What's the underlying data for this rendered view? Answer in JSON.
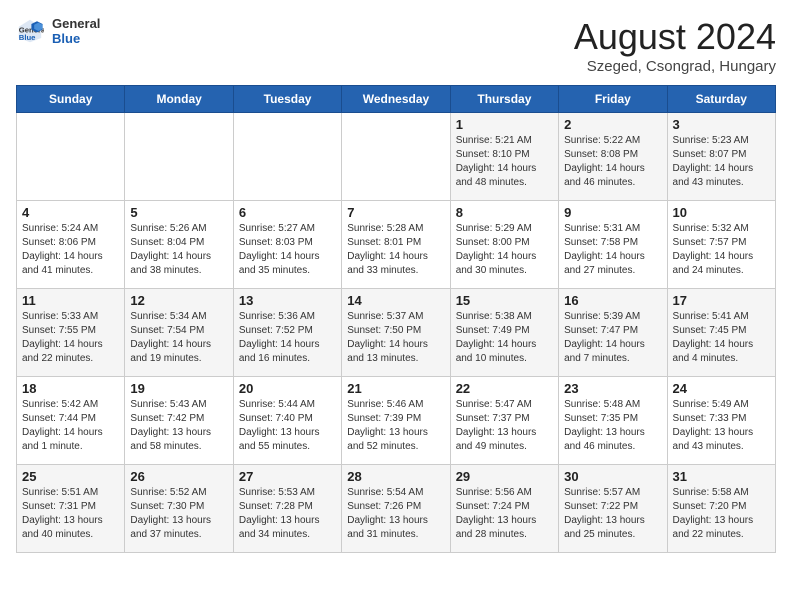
{
  "header": {
    "logo_general": "General",
    "logo_blue": "Blue",
    "title": "August 2024",
    "location": "Szeged, Csongrad, Hungary"
  },
  "days_of_week": [
    "Sunday",
    "Monday",
    "Tuesday",
    "Wednesday",
    "Thursday",
    "Friday",
    "Saturday"
  ],
  "weeks": [
    [
      {
        "day": "",
        "info": ""
      },
      {
        "day": "",
        "info": ""
      },
      {
        "day": "",
        "info": ""
      },
      {
        "day": "",
        "info": ""
      },
      {
        "day": "1",
        "info": "Sunrise: 5:21 AM\nSunset: 8:10 PM\nDaylight: 14 hours\nand 48 minutes."
      },
      {
        "day": "2",
        "info": "Sunrise: 5:22 AM\nSunset: 8:08 PM\nDaylight: 14 hours\nand 46 minutes."
      },
      {
        "day": "3",
        "info": "Sunrise: 5:23 AM\nSunset: 8:07 PM\nDaylight: 14 hours\nand 43 minutes."
      }
    ],
    [
      {
        "day": "4",
        "info": "Sunrise: 5:24 AM\nSunset: 8:06 PM\nDaylight: 14 hours\nand 41 minutes."
      },
      {
        "day": "5",
        "info": "Sunrise: 5:26 AM\nSunset: 8:04 PM\nDaylight: 14 hours\nand 38 minutes."
      },
      {
        "day": "6",
        "info": "Sunrise: 5:27 AM\nSunset: 8:03 PM\nDaylight: 14 hours\nand 35 minutes."
      },
      {
        "day": "7",
        "info": "Sunrise: 5:28 AM\nSunset: 8:01 PM\nDaylight: 14 hours\nand 33 minutes."
      },
      {
        "day": "8",
        "info": "Sunrise: 5:29 AM\nSunset: 8:00 PM\nDaylight: 14 hours\nand 30 minutes."
      },
      {
        "day": "9",
        "info": "Sunrise: 5:31 AM\nSunset: 7:58 PM\nDaylight: 14 hours\nand 27 minutes."
      },
      {
        "day": "10",
        "info": "Sunrise: 5:32 AM\nSunset: 7:57 PM\nDaylight: 14 hours\nand 24 minutes."
      }
    ],
    [
      {
        "day": "11",
        "info": "Sunrise: 5:33 AM\nSunset: 7:55 PM\nDaylight: 14 hours\nand 22 minutes."
      },
      {
        "day": "12",
        "info": "Sunrise: 5:34 AM\nSunset: 7:54 PM\nDaylight: 14 hours\nand 19 minutes."
      },
      {
        "day": "13",
        "info": "Sunrise: 5:36 AM\nSunset: 7:52 PM\nDaylight: 14 hours\nand 16 minutes."
      },
      {
        "day": "14",
        "info": "Sunrise: 5:37 AM\nSunset: 7:50 PM\nDaylight: 14 hours\nand 13 minutes."
      },
      {
        "day": "15",
        "info": "Sunrise: 5:38 AM\nSunset: 7:49 PM\nDaylight: 14 hours\nand 10 minutes."
      },
      {
        "day": "16",
        "info": "Sunrise: 5:39 AM\nSunset: 7:47 PM\nDaylight: 14 hours\nand 7 minutes."
      },
      {
        "day": "17",
        "info": "Sunrise: 5:41 AM\nSunset: 7:45 PM\nDaylight: 14 hours\nand 4 minutes."
      }
    ],
    [
      {
        "day": "18",
        "info": "Sunrise: 5:42 AM\nSunset: 7:44 PM\nDaylight: 14 hours\nand 1 minute."
      },
      {
        "day": "19",
        "info": "Sunrise: 5:43 AM\nSunset: 7:42 PM\nDaylight: 13 hours\nand 58 minutes."
      },
      {
        "day": "20",
        "info": "Sunrise: 5:44 AM\nSunset: 7:40 PM\nDaylight: 13 hours\nand 55 minutes."
      },
      {
        "day": "21",
        "info": "Sunrise: 5:46 AM\nSunset: 7:39 PM\nDaylight: 13 hours\nand 52 minutes."
      },
      {
        "day": "22",
        "info": "Sunrise: 5:47 AM\nSunset: 7:37 PM\nDaylight: 13 hours\nand 49 minutes."
      },
      {
        "day": "23",
        "info": "Sunrise: 5:48 AM\nSunset: 7:35 PM\nDaylight: 13 hours\nand 46 minutes."
      },
      {
        "day": "24",
        "info": "Sunrise: 5:49 AM\nSunset: 7:33 PM\nDaylight: 13 hours\nand 43 minutes."
      }
    ],
    [
      {
        "day": "25",
        "info": "Sunrise: 5:51 AM\nSunset: 7:31 PM\nDaylight: 13 hours\nand 40 minutes."
      },
      {
        "day": "26",
        "info": "Sunrise: 5:52 AM\nSunset: 7:30 PM\nDaylight: 13 hours\nand 37 minutes."
      },
      {
        "day": "27",
        "info": "Sunrise: 5:53 AM\nSunset: 7:28 PM\nDaylight: 13 hours\nand 34 minutes."
      },
      {
        "day": "28",
        "info": "Sunrise: 5:54 AM\nSunset: 7:26 PM\nDaylight: 13 hours\nand 31 minutes."
      },
      {
        "day": "29",
        "info": "Sunrise: 5:56 AM\nSunset: 7:24 PM\nDaylight: 13 hours\nand 28 minutes."
      },
      {
        "day": "30",
        "info": "Sunrise: 5:57 AM\nSunset: 7:22 PM\nDaylight: 13 hours\nand 25 minutes."
      },
      {
        "day": "31",
        "info": "Sunrise: 5:58 AM\nSunset: 7:20 PM\nDaylight: 13 hours\nand 22 minutes."
      }
    ]
  ]
}
